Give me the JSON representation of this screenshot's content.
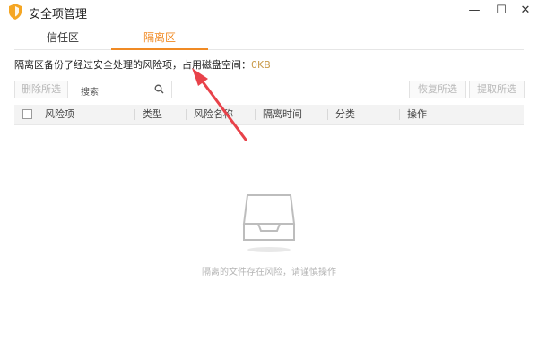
{
  "window": {
    "title": "安全项管理",
    "app_icon": "shield-icon",
    "controls": {
      "minimize": "—",
      "maximize": "☐",
      "close": "✕"
    }
  },
  "tabs": [
    {
      "label": "信任区",
      "active": false
    },
    {
      "label": "隔离区",
      "active": true
    }
  ],
  "info": {
    "text": "隔离区备份了经过安全处理的风险项，占用磁盘空间：",
    "size": "0KB"
  },
  "toolbar": {
    "delete_label": "删除所选",
    "search_placeholder": "搜索",
    "restore_label": "恢复所选",
    "extract_label": "提取所选"
  },
  "table": {
    "columns": [
      "风险项",
      "类型",
      "风险名称",
      "隔离时间",
      "分类",
      "操作"
    ],
    "rows": []
  },
  "empty_state": {
    "icon": "empty-tray-icon",
    "message": "隔离的文件存在风险，请谨慎操作"
  },
  "colors": {
    "accent": "#f08a24",
    "size_text": "#c99a4a",
    "arrow": "#e8424a"
  }
}
